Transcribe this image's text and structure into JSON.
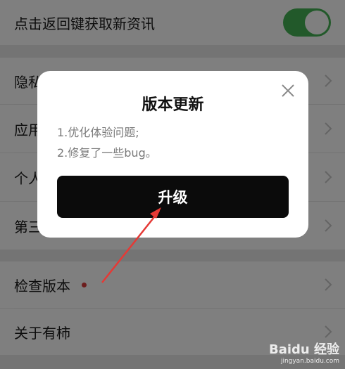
{
  "settings": {
    "items": [
      {
        "label": "点击返回键获取新资讯",
        "type": "toggle",
        "on": true
      },
      {
        "label": "隐私",
        "type": "nav"
      },
      {
        "label": "应用",
        "type": "nav"
      },
      {
        "label": "个人",
        "type": "nav"
      },
      {
        "label": "第三",
        "type": "nav"
      },
      {
        "label": "检查版本",
        "type": "nav",
        "badge": "red-dot"
      },
      {
        "label": "关于有柿",
        "type": "nav"
      }
    ]
  },
  "dialog": {
    "title": "版本更新",
    "notes": [
      "1.优化体验问题;",
      "2.修复了一些bug。"
    ],
    "button_label": "升级",
    "close_icon": "close-icon"
  },
  "annotation": {
    "color": "#e53935"
  },
  "watermark": {
    "main": "Baidu 经验",
    "url": "jingyan.baidu.com"
  },
  "colors": {
    "toggle_on": "#45b354",
    "button_bg": "#0b0b0b",
    "badge": "#d93a3a"
  }
}
